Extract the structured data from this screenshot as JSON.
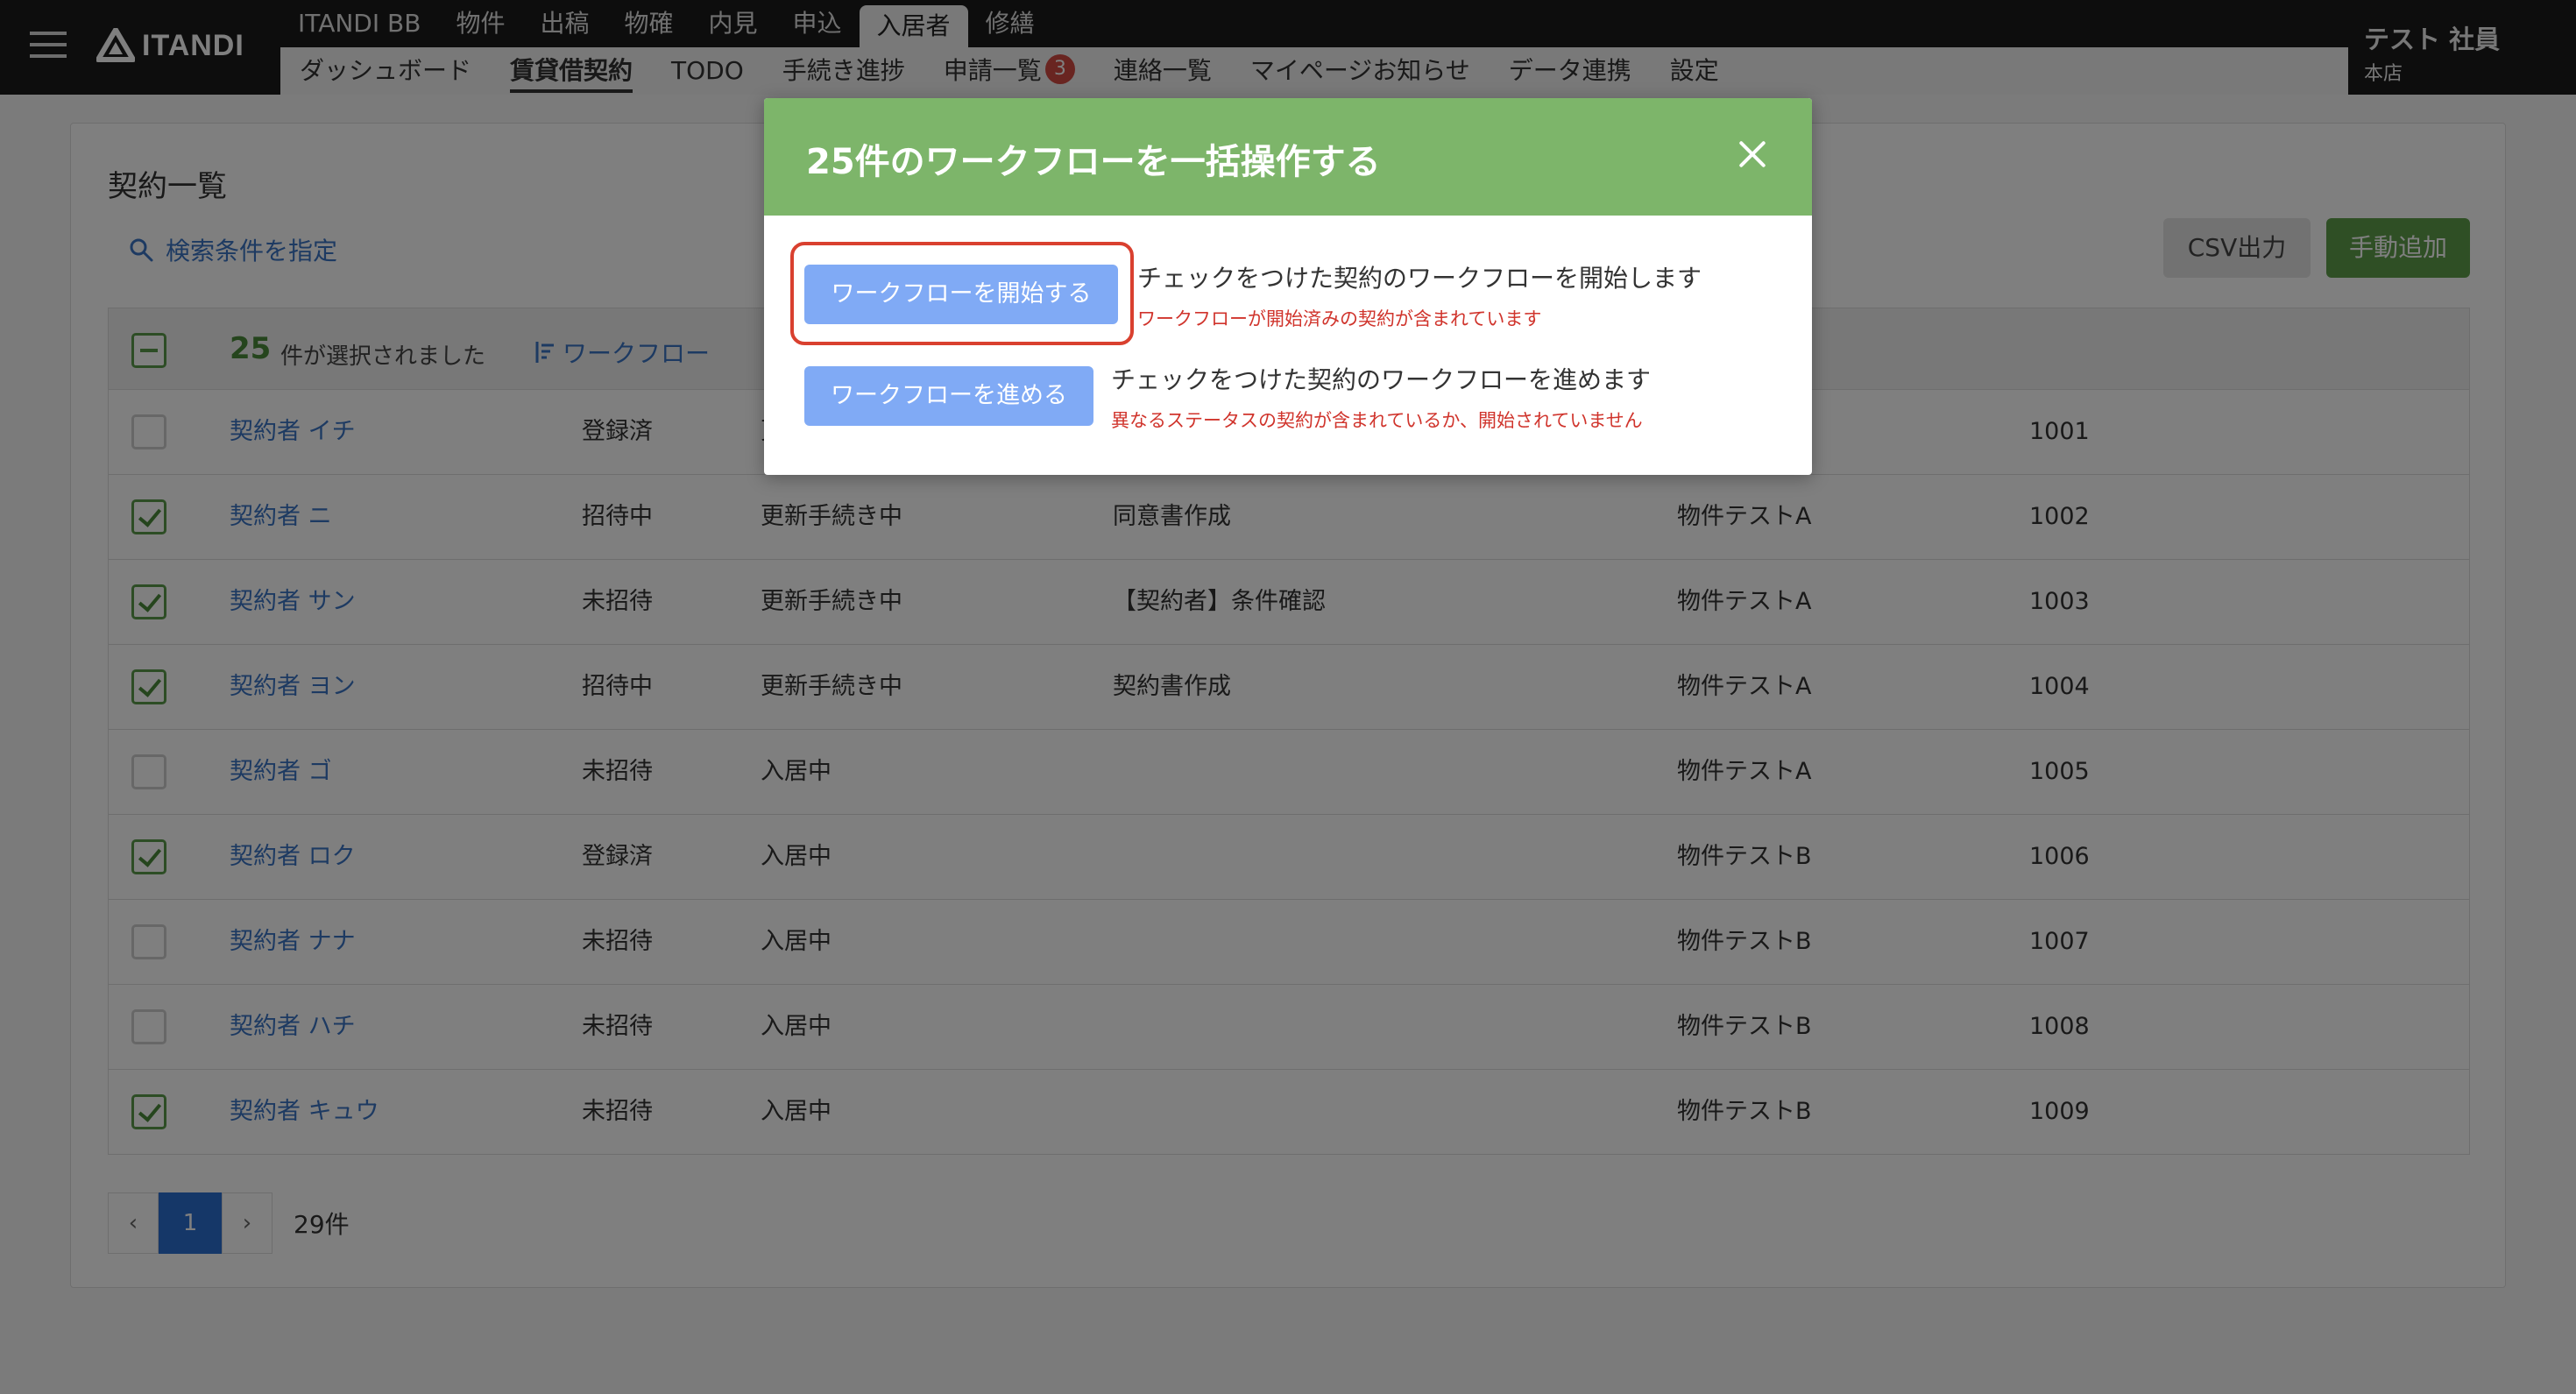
{
  "header": {
    "logo_text": "ITANDI",
    "top_nav": [
      "ITANDI BB",
      "物件",
      "出稿",
      "物確",
      "内見",
      "申込",
      "入居者",
      "修繕"
    ],
    "top_nav_active": "入居者",
    "sub_nav": [
      "ダッシュボード",
      "賃貸借契約",
      "TODO",
      "手続き進捗",
      "申請一覧",
      "連絡一覧",
      "マイページお知らせ",
      "データ連携",
      "設定"
    ],
    "sub_nav_active": "賃貸借契約",
    "applications_badge": "3",
    "user_name": "テスト 社員",
    "user_branch": "本店"
  },
  "page": {
    "title": "契約一覧",
    "search_link": "検索条件を指定",
    "csv_button": "CSV出力",
    "add_button": "手動追加"
  },
  "table": {
    "selected_count": "25",
    "selected_text": "件が選択されました",
    "workflow_sort": "ワークフロー",
    "rows": [
      {
        "checked": false,
        "name": "契約者 イチ",
        "status1": "登録済",
        "status2": "更",
        "task": "",
        "property": "",
        "number": "1001"
      },
      {
        "checked": true,
        "name": "契約者 ニ",
        "status1": "招待中",
        "status2": "更新手続き中",
        "task": "同意書作成",
        "property": "物件テストA",
        "number": "1002"
      },
      {
        "checked": true,
        "name": "契約者 サン",
        "status1": "未招待",
        "status2": "更新手続き中",
        "task": "【契約者】条件確認",
        "property": "物件テストA",
        "number": "1003"
      },
      {
        "checked": true,
        "name": "契約者 ヨン",
        "status1": "招待中",
        "status2": "更新手続き中",
        "task": "契約書作成",
        "property": "物件テストA",
        "number": "1004"
      },
      {
        "checked": false,
        "name": "契約者 ゴ",
        "status1": "未招待",
        "status2": "入居中",
        "task": "",
        "property": "物件テストA",
        "number": "1005"
      },
      {
        "checked": true,
        "name": "契約者 ロク",
        "status1": "登録済",
        "status2": "入居中",
        "task": "",
        "property": "物件テストB",
        "number": "1006"
      },
      {
        "checked": false,
        "name": "契約者 ナナ",
        "status1": "未招待",
        "status2": "入居中",
        "task": "",
        "property": "物件テストB",
        "number": "1007"
      },
      {
        "checked": false,
        "name": "契約者 ハチ",
        "status1": "未招待",
        "status2": "入居中",
        "task": "",
        "property": "物件テストB",
        "number": "1008"
      },
      {
        "checked": true,
        "name": "契約者 キュウ",
        "status1": "未招待",
        "status2": "入居中",
        "task": "",
        "property": "物件テストB",
        "number": "1009"
      }
    ]
  },
  "pager": {
    "prev": "‹",
    "current": "1",
    "next": "›",
    "total": "29件"
  },
  "modal": {
    "title": "25件のワークフローを一括操作する",
    "start_button": "ワークフローを開始する",
    "start_desc": "チェックをつけた契約のワークフローを開始します",
    "start_warn": "ワークフローが開始済みの契約が含まれています",
    "advance_button": "ワークフローを進める",
    "advance_desc": "チェックをつけた契約のワークフローを進めます",
    "advance_warn": "異なるステータスの契約が含まれているか、開始されていません"
  },
  "colors": {
    "header_bg": "#1a1a1a",
    "modal_header": "#7db56a",
    "primary_button": "#80aaf5",
    "add_button": "#5e9e4a",
    "link": "#3b74c4",
    "warning": "#d0342c",
    "highlight": "#d9402f"
  }
}
